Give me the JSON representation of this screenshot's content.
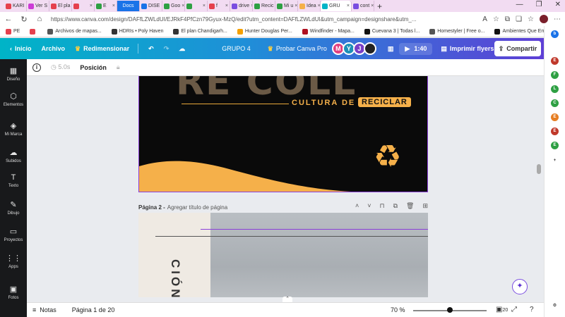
{
  "browser": {
    "tabs": [
      {
        "label": "KARI",
        "color": "#e5404d"
      },
      {
        "label": "Ver S",
        "color": "#cc3bd6"
      },
      {
        "label": "El pla",
        "color": "#e5404d"
      },
      {
        "label": "",
        "color": "#e5404d"
      },
      {
        "label": "E",
        "color": "#2ea043"
      },
      {
        "label": "Docs",
        "docs": true,
        "color": "#1a73e8"
      },
      {
        "label": "DISE",
        "color": "#1a73e8"
      },
      {
        "label": "Goo",
        "color": "#2ea043"
      },
      {
        "label": "",
        "color": "#2ea043"
      },
      {
        "label": "f",
        "color": "#e5404d"
      },
      {
        "label": "drive",
        "color": "#7a4de0"
      },
      {
        "label": "Recic",
        "color": "#2ea043"
      },
      {
        "label": "Mi u",
        "color": "#2ea043"
      },
      {
        "label": "Idea",
        "color": "#f5b04a"
      },
      {
        "label": "GRU",
        "active": true,
        "color": "#00b4c7"
      },
      {
        "label": "cont",
        "color": "#7a4de0"
      }
    ],
    "new_tab": "+",
    "url": "https://www.canva.com/design/DAFfLZWLdUI/EJRkF4PfCzn79Gyux-MzQ/edit?utm_content=DAFfLZWLdUI&utm_campaign=designshare&utm_...",
    "bookmarks": [
      {
        "label": "PE",
        "color": "#e5404d"
      },
      {
        "label": "",
        "color": "#e5404d"
      },
      {
        "label": "Archivos de mapas...",
        "color": "#555"
      },
      {
        "label": "HDRIs • Poly Haven",
        "color": "#333"
      },
      {
        "label": "El plan Chandigarh...",
        "color": "#333"
      },
      {
        "label": "Hunter Douglas Per...",
        "color": "#f5a000"
      },
      {
        "label": "Windfinder - Mapa...",
        "color": "#b01020"
      },
      {
        "label": "Cuevana 3 | Todas l...",
        "color": "#111"
      },
      {
        "label": "Homestyler | Free o...",
        "color": "#555"
      },
      {
        "label": "Ambientes Que Em...",
        "color": "#111"
      }
    ]
  },
  "canva": {
    "home_label": "Inicio",
    "file_label": "Archivo",
    "resize_label": "Redimensionar",
    "group_name": "GRUPO 4",
    "pro_label": "Probar Canva Pro",
    "collaborators": [
      {
        "initial": "M",
        "color": "#e04080"
      },
      {
        "initial": "Y",
        "color": "#1e8fb8"
      },
      {
        "initial": "J",
        "color": "#7a3fc6"
      }
    ],
    "timer": "1:40",
    "print_label": "Imprimir flyers",
    "share_label": "Compartir",
    "rail": [
      {
        "label": "Diseño",
        "icon": "▦"
      },
      {
        "label": "Elementos",
        "icon": "⬡"
      },
      {
        "label": "Mi Marca",
        "icon": "◈"
      },
      {
        "label": "Subidos",
        "icon": "☁"
      },
      {
        "label": "Texto",
        "icon": "T"
      },
      {
        "label": "Dibujo",
        "icon": "✎"
      },
      {
        "label": "Proyectos",
        "icon": "▭"
      },
      {
        "label": "Apps",
        "icon": "⋮⋮"
      },
      {
        "label": "Fotos",
        "icon": "▣"
      }
    ],
    "toolbar": {
      "duration": "5.0s",
      "position_label": "Posición"
    },
    "page1": {
      "big_text": "RE COLL",
      "cultura": "CULTURA DE",
      "reciclar": "RECICLAR"
    },
    "page2": {
      "label": "Página 2 -",
      "placeholder": "Agregar título de página",
      "vertical_text": "CIÓN"
    },
    "footer": {
      "notes_label": "Notas",
      "page_info": "Página 1 de 20",
      "zoom": "70 %",
      "page_count": "20"
    }
  },
  "colors": {
    "accent_purple": "#8b3fd9",
    "recycle_orange": "#f5b04a"
  }
}
